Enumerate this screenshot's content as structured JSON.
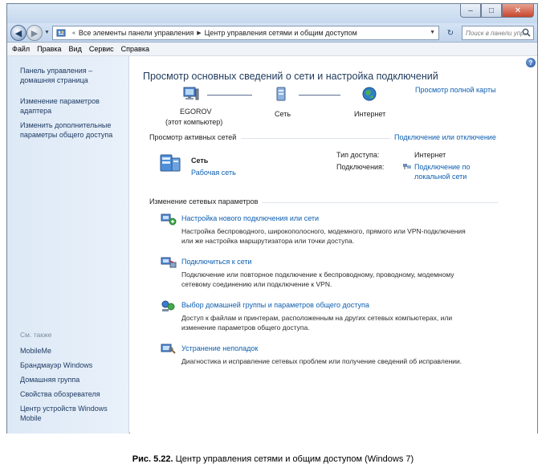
{
  "address": {
    "segment_1": "Все элементы панели управления",
    "segment_2": "Центр управления сетями и общим доступом"
  },
  "search": {
    "placeholder": "Поиск в панели упр..."
  },
  "menu": [
    "Файл",
    "Правка",
    "Вид",
    "Сервис",
    "Справка"
  ],
  "sidebar": {
    "home": "Панель управления – домашняя страница",
    "adapter": "Изменение параметров адаптера",
    "sharing": "Изменить дополнительные параметры общего доступа",
    "see_also": "См. также",
    "links": [
      "MobileMe",
      "Брандмауэр Windows",
      "Домашняя группа",
      "Свойства обозревателя",
      "Центр устройств Windows Mobile"
    ]
  },
  "main": {
    "title": "Просмотр основных сведений о сети и настройка подключений",
    "full_map": "Просмотр полной карты",
    "map": {
      "computer": "EGOROV",
      "computer_sub": "(этот компьютер)",
      "network": "Сеть",
      "internet": "Интернет"
    },
    "active_networks": "Просмотр активных сетей",
    "connect_disconnect": "Подключение или отключение",
    "network_name": "Сеть",
    "network_type": "Рабочая сеть",
    "access_type_label": "Тип доступа:",
    "access_type_value": "Интернет",
    "connections_label": "Подключения:",
    "connections_value_1": "Подключение по",
    "connections_value_2": "локальной сети",
    "change_settings": "Изменение сетевых параметров",
    "tasks": [
      {
        "title": "Настройка нового подключения или сети",
        "desc1": "Настройка беспроводного, широкополосного, модемного, прямого или VPN-подключения",
        "desc2": "или же настройка маршрутизатора или точки доступа."
      },
      {
        "title": "Подключиться к сети",
        "desc1": "Подключение или повторное подключение к беспроводному, проводному, модемному",
        "desc2": "сетевому соединению или подключение к VPN."
      },
      {
        "title": "Выбор домашней группы и параметров общего доступа",
        "desc1": "Доступ к файлам и принтерам, расположенным на других сетевых компьютерах, или",
        "desc2": "изменение параметров общего доступа."
      },
      {
        "title": "Устранение неполадок",
        "desc1": "Диагностика и исправление сетевых проблем или получение сведений об исправлении.",
        "desc2": ""
      }
    ]
  },
  "caption": {
    "label": "Рис. 5.22.",
    "text": "Центр управления сетями и общим доступом (Windows 7)"
  },
  "colors": {
    "link": "#0e5fb0",
    "title": "#1e395b",
    "sidebar": "#dde9f6"
  }
}
